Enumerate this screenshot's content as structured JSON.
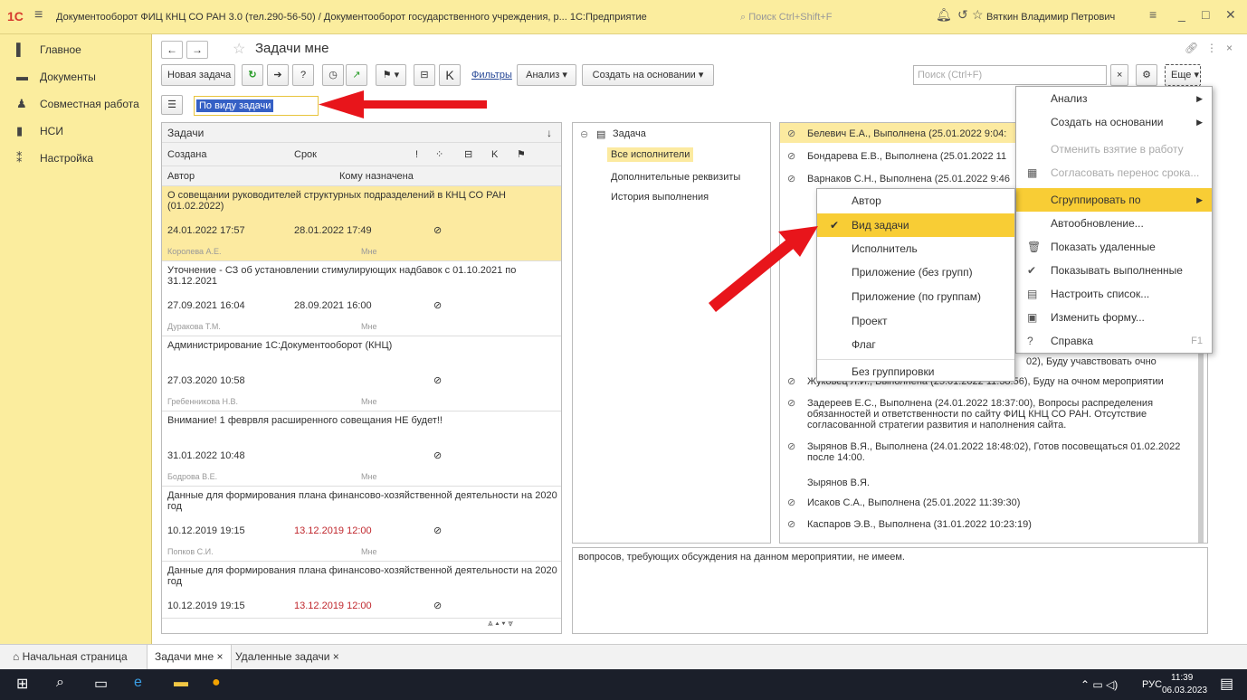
{
  "titlebar": {
    "logo": "1С",
    "title": "Документооборот ФИЦ КНЦ СО РАН 3.0 (тел.290-56-50) / Документооборот государственного учреждения, р...  1С:Предприятие",
    "search_placeholder": "Поиск Ctrl+Shift+F",
    "user": "Вяткин Владимир Петрович"
  },
  "sidebar": {
    "items": [
      {
        "label": "Главное",
        "icon": "menu-icon"
      },
      {
        "label": "Документы",
        "icon": "folder-icon"
      },
      {
        "label": "Совместная работа",
        "icon": "people-icon"
      },
      {
        "label": "НСИ",
        "icon": "book-icon"
      },
      {
        "label": "Настройка",
        "icon": "settings-icon"
      }
    ]
  },
  "header": {
    "title": "Задачи мне"
  },
  "toolbar": {
    "new_task": "Новая задача",
    "filters": "Фильтры",
    "analysis": "Анализ",
    "create_based": "Создать на основании",
    "search_placeholder": "Поиск (Ctrl+F)",
    "more": "Еще"
  },
  "grouping": {
    "value": "По виду задачи"
  },
  "list": {
    "header": "Задачи",
    "col_created": "Создана",
    "col_due": "Срок",
    "col_author": "Автор",
    "col_assignee": "Кому назначена",
    "tasks": [
      {
        "subject": "О совещании руководителей структурных подразделений в КНЦ СО РАН (01.02.2022)",
        "created": "24.01.2022 17:57",
        "due": "28.01.2022 17:49",
        "author": "Королева А.Е.",
        "assignee": "Мне"
      },
      {
        "subject": "Уточнение - СЗ об установлении стимулирующих надбавок с 01.10.2021 по 31.12.2021",
        "created": "27.09.2021 16:04",
        "due": "28.09.2021 16:00",
        "author": "Дуракова Т.М.",
        "assignee": "Мне"
      },
      {
        "subject": "Администрирование 1С:Документооборот (КНЦ)",
        "created": "27.03.2020 10:58",
        "due": "",
        "author": "Гребенникова Н.В.",
        "assignee": "Мне"
      },
      {
        "subject": "Внимание! 1 феврвля расширенного совещания НЕ будет!!",
        "created": "31.01.2022 10:48",
        "due": "",
        "author": "Бодрова В.Е.",
        "assignee": "Мне"
      },
      {
        "subject": "Данные для формирования плана финансово-хозяйственной деятельности на 2020 год",
        "created": "10.12.2019 19:15",
        "due": "13.12.2019 12:00",
        "author": "Попков С.И.",
        "assignee": "Мне"
      },
      {
        "subject": "Данные для формирования плана финансово-хозяйственной деятельности на 2020 год",
        "created": "10.12.2019 19:15",
        "due": "13.12.2019 12:00",
        "author": "",
        "assignee": ""
      }
    ]
  },
  "tree": {
    "root": "Задача",
    "items": [
      "Все исполнители",
      "Дополнительные реквизиты",
      "История выполнения"
    ]
  },
  "history": {
    "rows": [
      "Белевич Е.А., Выполнена (25.01.2022 9:04:",
      "Бондарева Е.В., Выполнена (25.01.2022 11",
      "Варнаков С.Н., Выполнена (25.01.2022 9:46",
      "02), Буду учавствовать очно",
      "Жуковец Л.И., Выполнена (25.01.2022 11:38:56), Буду на очном мероприятии",
      "Задереев Е.С., Выполнена (24.01.2022 18:37:00), Вопросы распределения обязанностей и ответственности по сайту ФИЦ КНЦ СО РАН. Отсутствие согласованной стратегии развития и наполнения сайта.",
      "Зырянов В.Я., Выполнена (24.01.2022 18:48:02), Готов посовещаться 01.02.2022 после 14:00.",
      "Зырянов В.Я.",
      "Исаков С.А., Выполнена (25.01.2022 11:39:30)",
      "Каспаров Э.В., Выполнена (31.01.2022 10:23:19)"
    ]
  },
  "detail_text": "вопросов, требующих обсуждения на данном мероприятии, не имеем.",
  "more_menu": {
    "items": [
      "Анализ",
      "Создать на основании",
      "Отменить взятие в работу",
      "Согласовать перенос срока...",
      "Сгруппировать по",
      "Автообновление...",
      "Показать удаленные",
      "Показывать выполненные",
      "Настроить список...",
      "Изменить форму...",
      "Справка"
    ],
    "help_shortcut": "F1"
  },
  "group_menu": {
    "items": [
      "Автор",
      "Вид задачи",
      "Исполнитель",
      "Приложение (без групп)",
      "Приложение (по группам)",
      "Проект",
      "Флаг",
      "Без группировки"
    ]
  },
  "tabs": [
    "Начальная страница",
    "Задачи мне ×",
    "Удаленные задачи ×"
  ],
  "taskbar": {
    "lang": "РУС",
    "time": "11:39",
    "date": "06.03.2023"
  },
  "colors": {
    "accent": "#fbed9e",
    "highlight": "#f8cd35",
    "arrow": "#e8151b"
  }
}
